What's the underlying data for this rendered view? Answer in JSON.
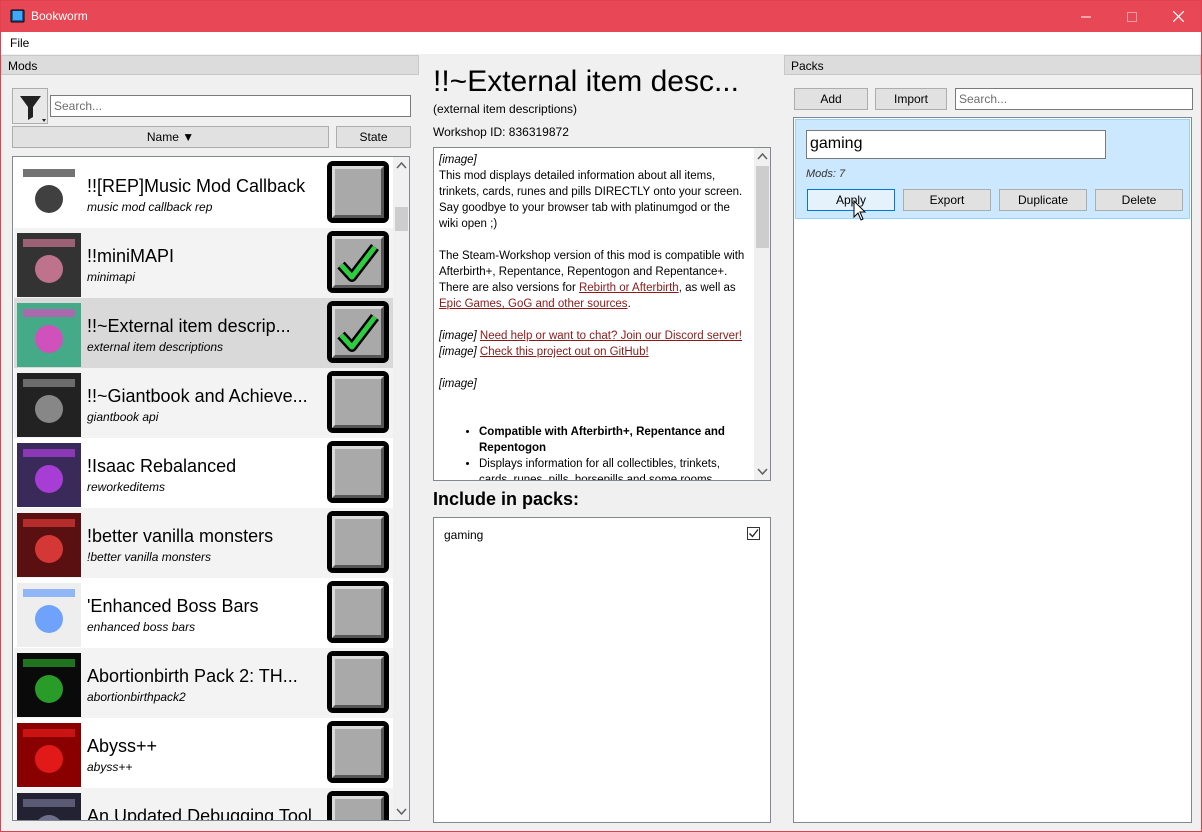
{
  "window": {
    "title": "Bookworm",
    "accent": "#e84855"
  },
  "menu": {
    "file": "File"
  },
  "mods_panel": {
    "header": "Mods",
    "search_placeholder": "Search...",
    "sort_name": "Name ▼",
    "sort_state": "State",
    "items": [
      {
        "name": "!![REP]Music Mod Callback",
        "sub": "music mod callback rep",
        "checked": false,
        "thumb": "music-mod-callback-thumbnail"
      },
      {
        "name": "!!miniMAPI",
        "sub": "minimapi",
        "checked": true,
        "thumb": "minimapi-thumbnail"
      },
      {
        "name": "!!~External item descrip...",
        "sub": "external item descriptions",
        "checked": true,
        "selected": true,
        "thumb": "external-item-descriptions-thumbnail"
      },
      {
        "name": "!!~Giantbook and Achieve...",
        "sub": "giantbook api",
        "checked": false,
        "thumb": "giantbook-api-thumbnail"
      },
      {
        "name": "!Isaac Rebalanced",
        "sub": "reworkeditems",
        "checked": false,
        "thumb": "isaac-rebalanced-thumbnail"
      },
      {
        "name": "!better vanilla monsters",
        "sub": "!better vanilla monsters",
        "checked": false,
        "thumb": "better-vanilla-monsters-thumbnail"
      },
      {
        "name": "'Enhanced Boss Bars",
        "sub": "enhanced boss bars",
        "checked": false,
        "thumb": "enhanced-boss-bars-thumbnail"
      },
      {
        "name": "Abortionbirth Pack 2: TH...",
        "sub": "abortionbirthpack2",
        "checked": false,
        "thumb": "abortionbirth-thumbnail"
      },
      {
        "name": "Abyss++",
        "sub": "abyss++",
        "checked": false,
        "thumb": "abyss-thumbnail"
      },
      {
        "name": "An Updated Debugging Tool",
        "sub": "",
        "checked": false,
        "thumb": "debugging-tool-thumbnail"
      }
    ]
  },
  "detail": {
    "title": "!!~External item desc...",
    "subtitle": "(external item descriptions)",
    "workshop_id": "Workshop ID: 836319872",
    "desc": {
      "img1": "[image]",
      "p1": "This mod displays detailed information about all items, trinkets, cards, runes and pills DIRECTLY onto your screen. Say goodbye to your browser tab with platinumgod or the wiki open ;)",
      "p2a": "The Steam-Workshop version of this mod is compatible with Afterbirth+, Repentance, Repentogon and Repentance+. There are also versions for ",
      "p2_link1": "Rebirth or Afterbirth",
      "p2b": ", as well as ",
      "p2_link2": "Epic Games, GoG and other sources",
      "p2c": ".",
      "img2": "[image]",
      "link3": "Need help or want to chat? Join our Discord server!",
      "img3": "[image]",
      "link4": "Check this project out on GitHub!",
      "img4": "[image]",
      "bullet1": "Compatible with Afterbirth+, Repentance and Repentogon",
      "bullet2": "Displays information for all collectibles, trinkets, cards, runes, pills, horsepills and some rooms"
    },
    "include_heading": "Include in packs:",
    "packs": [
      {
        "name": "gaming",
        "checked": true
      }
    ]
  },
  "packs_panel": {
    "header": "Packs",
    "add": "Add",
    "import": "Import",
    "search_placeholder": "Search...",
    "pack": {
      "name": "gaming",
      "mods_count": "Mods: 7",
      "apply": "Apply",
      "export": "Export",
      "duplicate": "Duplicate",
      "delete": "Delete"
    }
  },
  "colors": {
    "pack_selected_bg": "#cce8ff",
    "check_green": "#2ecc40",
    "link": "#8b1a1a"
  }
}
